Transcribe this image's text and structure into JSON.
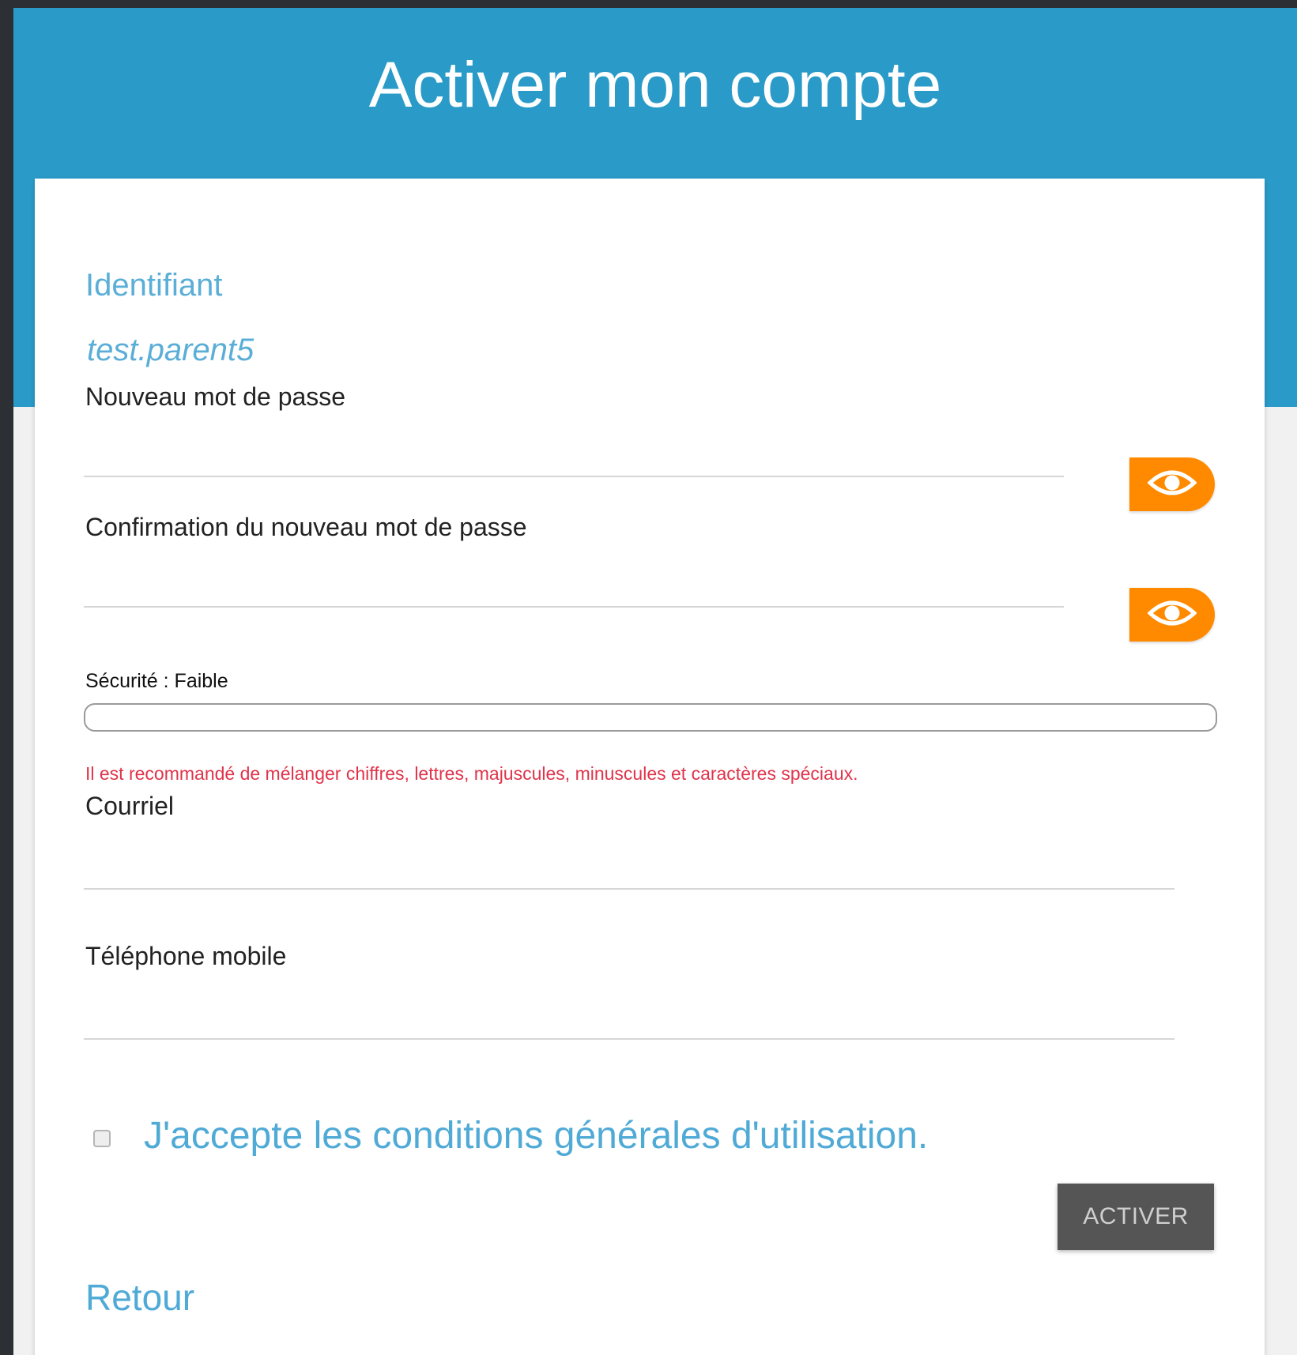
{
  "header": {
    "title": "Activer mon compte"
  },
  "form": {
    "identifier_label": "Identifiant",
    "identifier_value": "test.parent5",
    "new_password_label": "Nouveau mot de passe",
    "new_password_value": "",
    "confirm_password_label": "Confirmation du nouveau mot de passe",
    "confirm_password_value": "",
    "toggle_visibility_icon": "eye-icon",
    "strength_label": "Sécurité : Faible",
    "strength_level": 0,
    "hint": "Il est recommandé de mélanger chiffres, lettres, majuscules, minuscules et caractères spéciaux.",
    "email_label": "Courriel",
    "email_value": "",
    "mobile_label": "Téléphone mobile",
    "mobile_value": "",
    "terms_checked": false,
    "terms_label": "J'accepte les conditions générales d'utilisation.",
    "submit_label": "ACTIVER",
    "back_label": "Retour"
  },
  "colors": {
    "header_bg": "#2a9bc8",
    "accent_text": "#4faad6",
    "eye_button": "#ff8a00",
    "hint_text": "#e0334a",
    "submit_bg": "#555555"
  }
}
